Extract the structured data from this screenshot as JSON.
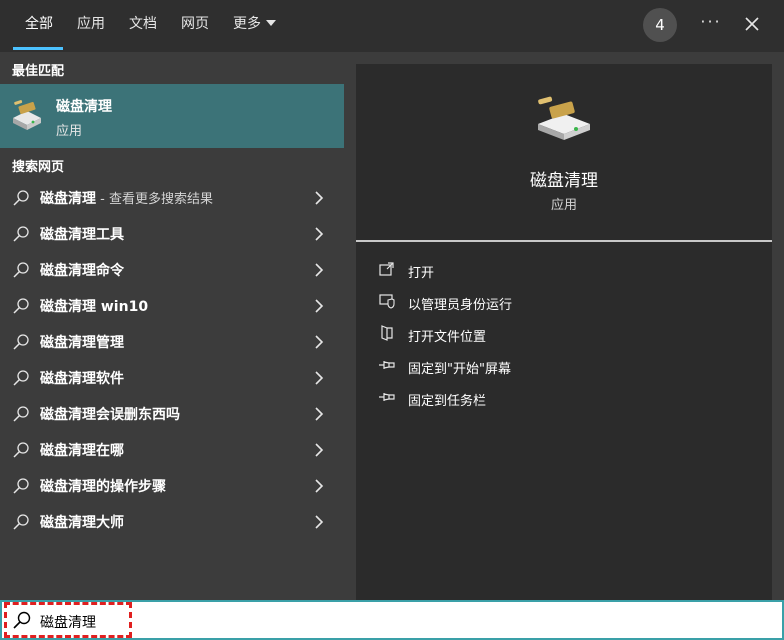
{
  "tabs": {
    "all": "全部",
    "apps": "应用",
    "docs": "文档",
    "web": "网页",
    "more": "更多",
    "badge": "4",
    "ellipsis": "···"
  },
  "best_match": {
    "section_title": "最佳匹配",
    "title": "磁盘清理",
    "subtitle": "应用",
    "icon": "disk-cleanup-icon"
  },
  "web_search": {
    "section_title": "搜索网页",
    "items": [
      {
        "label": "磁盘清理",
        "suffix": " - 查看更多搜索结果"
      },
      {
        "label": "磁盘清理工具"
      },
      {
        "label": "磁盘清理命令"
      },
      {
        "label": "磁盘清理 win10"
      },
      {
        "label": "磁盘清理管理"
      },
      {
        "label": "磁盘清理软件"
      },
      {
        "label": "磁盘清理会误删东西吗"
      },
      {
        "label": "磁盘清理在哪"
      },
      {
        "label": "磁盘清理的操作步骤"
      },
      {
        "label": "磁盘清理大师"
      }
    ]
  },
  "preview": {
    "title": "磁盘清理",
    "subtitle": "应用",
    "actions": [
      {
        "label": "打开",
        "icon": "open-icon"
      },
      {
        "label": "以管理员身份运行",
        "icon": "admin-shield-icon"
      },
      {
        "label": "打开文件位置",
        "icon": "file-location-icon"
      },
      {
        "label": "固定到\"开始\"屏幕",
        "icon": "pin-icon"
      },
      {
        "label": "固定到任务栏",
        "icon": "pin-icon"
      }
    ]
  },
  "search": {
    "value": "磁盘清理"
  },
  "colors": {
    "accent": "#4cc2ff",
    "best_match_bg": "#3c7378",
    "highlight": "#e02020"
  }
}
